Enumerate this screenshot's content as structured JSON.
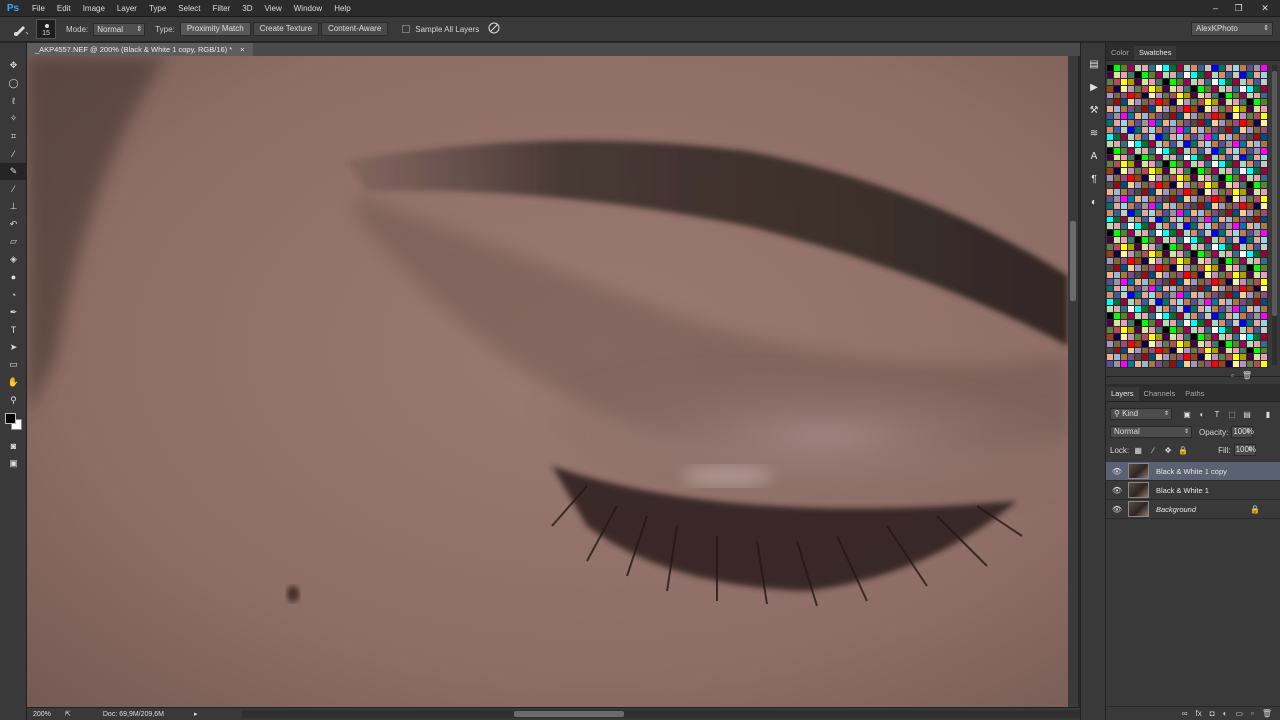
{
  "app": {
    "logo": "Ps"
  },
  "menu": [
    "File",
    "Edit",
    "Image",
    "Layer",
    "Type",
    "Select",
    "Filter",
    "3D",
    "View",
    "Window",
    "Help"
  ],
  "window_controls": {
    "minimize": "–",
    "restore": "❐",
    "close": "✕"
  },
  "options": {
    "brush_size": "15",
    "mode_label": "Mode:",
    "mode_value": "Normal",
    "type_label": "Type:",
    "type_buttons": [
      "Proximity Match",
      "Create Texture",
      "Content-Aware"
    ],
    "sample_all_label": "Sample All Layers",
    "workspace": "AlexKPhoto"
  },
  "document": {
    "tab_title": "_AKP4557.NEF @ 200% (Black & White 1 copy, RGB/16) *",
    "tab_close": "×"
  },
  "status": {
    "zoom": "200%",
    "doc": "Doc: 69,9M/209,6M"
  },
  "color_panel": {
    "tabs": [
      "Color",
      "Swatches"
    ],
    "active": "Swatches"
  },
  "swatch_colors": [
    "#000000",
    "#ffffff",
    "#c8c8c8",
    "#969696",
    "#4b4b4b",
    "#ff0000",
    "#ffff00",
    "#00ff00",
    "#00ffff",
    "#0000ff",
    "#ff00ff",
    "#9e0b0f",
    "#a0410d",
    "#aba000",
    "#598527",
    "#007236",
    "#00746b",
    "#0076a3",
    "#004b80",
    "#0d004c",
    "#4b0049",
    "#9e005d",
    "#9e0039",
    "#e8a4a1",
    "#efb08a",
    "#f7cf8f",
    "#fcf49e",
    "#d2e69c",
    "#b4dcb1",
    "#a5d7c6",
    "#99d5e4",
    "#9bb5dc",
    "#a293c5",
    "#bc8fc0",
    "#e89dbf",
    "#e6a3b0",
    "#d98a6a",
    "#c47a4a",
    "#a8793c",
    "#7d6a3a",
    "#5f7f44",
    "#3d7a66",
    "#2e6f8a",
    "#3b5e9a",
    "#5a4f9a",
    "#7a4a8c",
    "#9a4a7a",
    "#b44a5c"
  ],
  "layers_panel": {
    "tabs": [
      "Layers",
      "Channels",
      "Paths"
    ],
    "active": "Layers",
    "filter": "Kind",
    "blend_mode": "Normal",
    "opacity_label": "Opacity:",
    "opacity": "100%",
    "lock_label": "Lock:",
    "fill_label": "Fill:",
    "fill": "100%",
    "layers": [
      {
        "name": "Black & White 1 copy",
        "selected": true,
        "locked": false
      },
      {
        "name": "Black & White 1",
        "selected": false,
        "locked": false
      },
      {
        "name": "Background",
        "selected": false,
        "locked": true
      }
    ]
  }
}
